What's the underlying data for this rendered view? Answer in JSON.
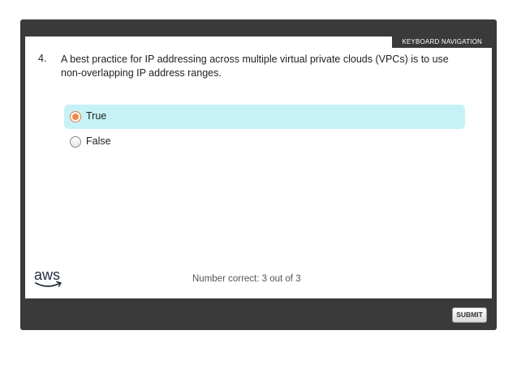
{
  "toolbar": {
    "keyboard_navigation_label": "KEYBOARD NAVIGATION"
  },
  "question": {
    "number": "4.",
    "text": "A best practice for IP addressing across multiple virtual private clouds (VPCs) is to use non-overlapping IP address ranges."
  },
  "options": [
    {
      "label": "True",
      "selected": true
    },
    {
      "label": "False",
      "selected": false
    }
  ],
  "logo": {
    "text": "aws",
    "accent_color": "#ff9900"
  },
  "score": {
    "text": "Number correct: 3 out of 3"
  },
  "actions": {
    "submit_label": "SUBMIT"
  },
  "colors": {
    "frame": "#3a3a3a",
    "selected_option_bg": "#c6f2f7",
    "radio_checked": "#f08a4b"
  }
}
